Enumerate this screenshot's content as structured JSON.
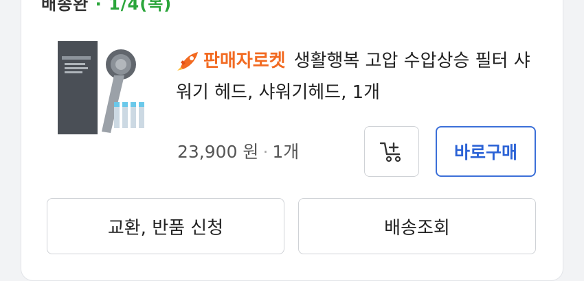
{
  "product": {
    "badge": "판매자로켓",
    "title": "생활행복 고압 수압상승 필터 샤워기 헤드, 샤워기헤드, 1개",
    "price": "23,900 원",
    "quantity": "1개",
    "image_icon": "shower-head-product-image",
    "badge_color": "#f26a21"
  },
  "actions": {
    "cart_icon": "cart-plus-icon",
    "buy_now_label": "바로구매",
    "exchange_return_label": "교환, 반품 신청",
    "tracking_label": "배송조회",
    "accent_color": "#3b6fd8"
  }
}
